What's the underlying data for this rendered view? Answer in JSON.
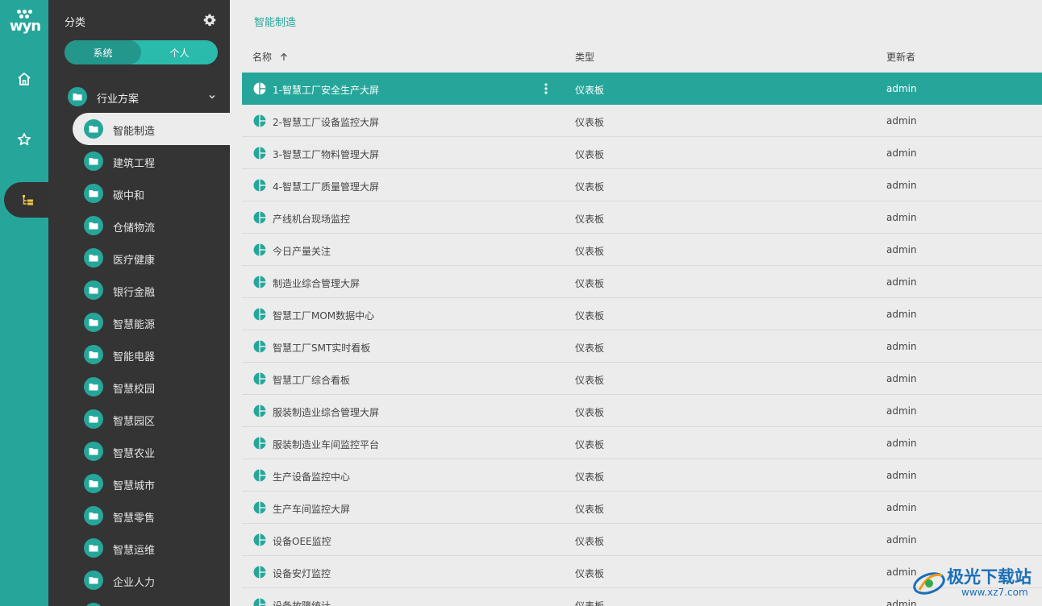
{
  "brand": {
    "logo_text": "wyn"
  },
  "rail": {
    "home_icon": "home-icon",
    "favorites_icon": "star-icon",
    "category_icon": "tree-icon"
  },
  "sidebar": {
    "title": "分类",
    "segments": {
      "system": "系统",
      "personal": "个人",
      "active": "system"
    },
    "group": {
      "label": "行业方案",
      "expanded": true
    },
    "items": [
      {
        "label": "智能制造",
        "active": true
      },
      {
        "label": "建筑工程"
      },
      {
        "label": "碳中和"
      },
      {
        "label": "仓储物流"
      },
      {
        "label": "医疗健康"
      },
      {
        "label": "银行金融"
      },
      {
        "label": "智慧能源"
      },
      {
        "label": "智能电器"
      },
      {
        "label": "智慧校园"
      },
      {
        "label": "智慧园区"
      },
      {
        "label": "智慧农业"
      },
      {
        "label": "智慧城市"
      },
      {
        "label": "智慧零售"
      },
      {
        "label": "智慧运维"
      },
      {
        "label": "企业人力"
      },
      {
        "label": ""
      }
    ]
  },
  "main": {
    "breadcrumb": "智能制造",
    "columns": {
      "name": "名称",
      "type": "类型",
      "updater": "更新者"
    },
    "rows": [
      {
        "name": "1-智慧工厂安全生产大屏",
        "type": "仪表板",
        "updater": "admin",
        "selected": true
      },
      {
        "name": "2-智慧工厂设备监控大屏",
        "type": "仪表板",
        "updater": "admin"
      },
      {
        "name": "3-智慧工厂物料管理大屏",
        "type": "仪表板",
        "updater": "admin"
      },
      {
        "name": "4-智慧工厂质量管理大屏",
        "type": "仪表板",
        "updater": "admin"
      },
      {
        "name": "产线机台现场监控",
        "type": "仪表板",
        "updater": "admin"
      },
      {
        "name": "今日产量关注",
        "type": "仪表板",
        "updater": "admin"
      },
      {
        "name": "制造业综合管理大屏",
        "type": "仪表板",
        "updater": "admin"
      },
      {
        "name": "智慧工厂MOM数据中心",
        "type": "仪表板",
        "updater": "admin"
      },
      {
        "name": "智慧工厂SMT实时看板",
        "type": "仪表板",
        "updater": "admin"
      },
      {
        "name": "智慧工厂综合看板",
        "type": "仪表板",
        "updater": "admin"
      },
      {
        "name": "服装制造业综合管理大屏",
        "type": "仪表板",
        "updater": "admin"
      },
      {
        "name": "服装制造业车间监控平台",
        "type": "仪表板",
        "updater": "admin"
      },
      {
        "name": "生产设备监控中心",
        "type": "仪表板",
        "updater": "admin"
      },
      {
        "name": "生产车间监控大屏",
        "type": "仪表板",
        "updater": "admin"
      },
      {
        "name": "设备OEE监控",
        "type": "仪表板",
        "updater": "admin"
      },
      {
        "name": "设备安灯监控",
        "type": "仪表板",
        "updater": "admin"
      },
      {
        "name": "设备故障统计",
        "type": "仪表板",
        "updater": "admin"
      }
    ]
  },
  "watermark": {
    "text": "极光下载站",
    "url": "www.xz7.com"
  },
  "colors": {
    "accent": "#26a69a",
    "sidebar_bg": "#343434",
    "main_bg": "#ececec"
  }
}
